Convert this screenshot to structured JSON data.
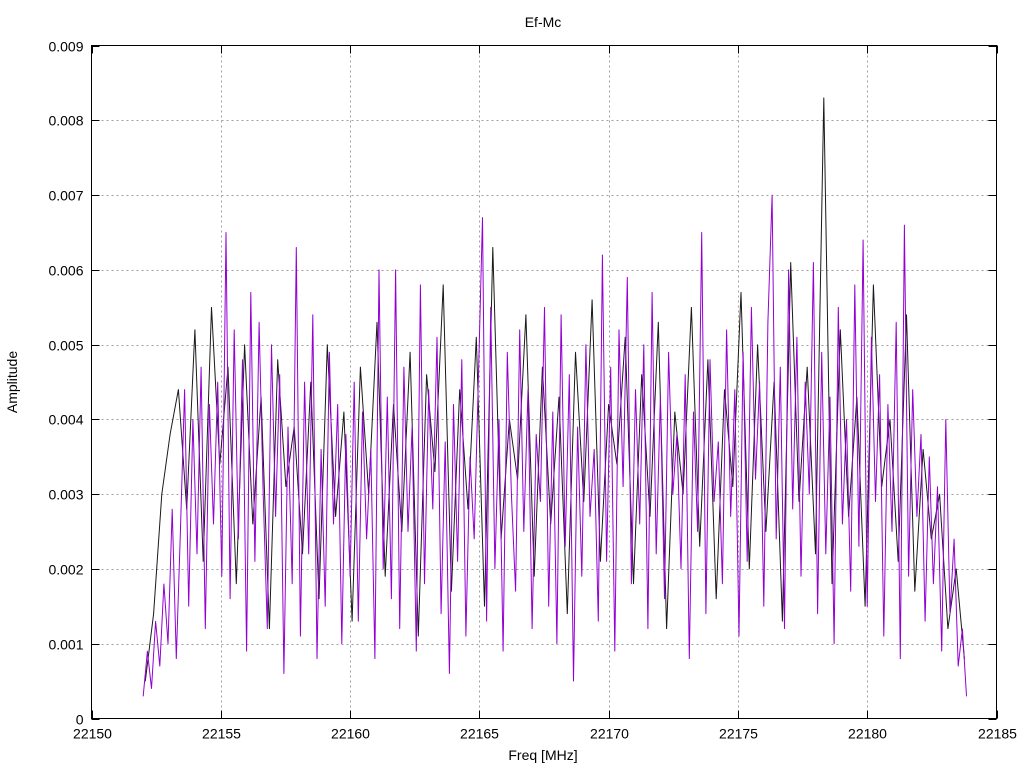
{
  "chart_data": {
    "type": "line",
    "title": "Ef-Mc",
    "xlabel": "Freq [MHz]",
    "ylabel": "Amplitude",
    "xlim": [
      22150,
      22185
    ],
    "ylim": [
      0,
      0.009
    ],
    "grid": true,
    "x_ticks": [
      "22150",
      "22155",
      "22160",
      "22165",
      "22170",
      "22175",
      "22180",
      "22185"
    ],
    "x_tick_values": [
      22150,
      22155,
      22160,
      22165,
      22170,
      22175,
      22180,
      22185
    ],
    "y_ticks": [
      "0",
      "0.001",
      "0.002",
      "0.003",
      "0.004",
      "0.005",
      "0.006",
      "0.007",
      "0.008",
      "0.009"
    ],
    "y_tick_values": [
      0,
      0.001,
      0.002,
      0.003,
      0.004,
      0.005,
      0.006,
      0.007,
      0.008,
      0.009
    ],
    "series": [
      {
        "color": "#1a1a1a",
        "x_start": 22152.08,
        "x_step": 0.32,
        "values": [
          0.0005,
          0.0014,
          0.003,
          0.0038,
          0.0044,
          0.0028,
          0.0052,
          0.0021,
          0.0055,
          0.0034,
          0.0047,
          0.0018,
          0.005,
          0.0026,
          0.0043,
          0.0012,
          0.0048,
          0.0031,
          0.0039,
          0.0022,
          0.0045,
          0.0016,
          0.005,
          0.0027,
          0.0041,
          0.0013,
          0.0047,
          0.003,
          0.0053,
          0.0019,
          0.0042,
          0.0025,
          0.0049,
          0.0011,
          0.0046,
          0.0033,
          0.0058,
          0.0017,
          0.0044,
          0.0028,
          0.0051,
          0.0015,
          0.0063,
          0.0024,
          0.004,
          0.0032,
          0.0054,
          0.0019,
          0.0047,
          0.0026,
          0.0043,
          0.0014,
          0.0049,
          0.0029,
          0.0056,
          0.0021,
          0.0042,
          0.0034,
          0.0051,
          0.0018,
          0.0046,
          0.0027,
          0.0053,
          0.0012,
          0.0041,
          0.003,
          0.0055,
          0.0023,
          0.0048,
          0.0016,
          0.0044,
          0.0031,
          0.0057,
          0.002,
          0.005,
          0.0025,
          0.0045,
          0.0013,
          0.0061,
          0.0029,
          0.0047,
          0.0022,
          0.0083,
          0.0018,
          0.0052,
          0.0027,
          0.0043,
          0.0015,
          0.0058,
          0.0031,
          0.004,
          0.0021,
          0.0054,
          0.0017,
          0.0036,
          0.0024,
          0.003,
          0.0012,
          0.002,
          0.0008
        ]
      },
      {
        "color": "#9400d3",
        "x_start": 22152.0,
        "x_step": 0.16,
        "values": [
          0.0003,
          0.0009,
          0.0004,
          0.0013,
          0.0007,
          0.0018,
          0.001,
          0.0028,
          0.0008,
          0.0025,
          0.0044,
          0.0015,
          0.004,
          0.0022,
          0.0047,
          0.0012,
          0.0042,
          0.0026,
          0.0045,
          0.0019,
          0.0065,
          0.0016,
          0.0052,
          0.0024,
          0.0048,
          0.0009,
          0.0057,
          0.0021,
          0.0053,
          0.003,
          0.0012,
          0.005,
          0.0027,
          0.0046,
          0.0006,
          0.0039,
          0.0018,
          0.0063,
          0.0011,
          0.0045,
          0.0022,
          0.0054,
          0.0008,
          0.0036,
          0.0015,
          0.0049,
          0.0026,
          0.0042,
          0.001,
          0.0038,
          0.0019,
          0.0045,
          0.0013,
          0.0041,
          0.0024,
          0.0036,
          0.0008,
          0.006,
          0.002,
          0.0043,
          0.0016,
          0.006,
          0.0012,
          0.0047,
          0.0025,
          0.0039,
          0.0009,
          0.0058,
          0.0018,
          0.0044,
          0.0028,
          0.0051,
          0.0014,
          0.0037,
          0.0006,
          0.0042,
          0.0021,
          0.0048,
          0.0011,
          0.0035,
          0.0024,
          0.0045,
          0.0067,
          0.0013,
          0.0055,
          0.002,
          0.004,
          0.0009,
          0.0049,
          0.003,
          0.0017,
          0.0052,
          0.0025,
          0.0044,
          0.0012,
          0.0038,
          0.0029,
          0.0055,
          0.0015,
          0.0041,
          0.001,
          0.0054,
          0.0023,
          0.0046,
          0.0005,
          0.0039,
          0.0019,
          0.005,
          0.0027,
          0.0036,
          0.0013,
          0.0062,
          0.0021,
          0.0047,
          0.0009,
          0.0052,
          0.0031,
          0.0059,
          0.0018,
          0.0044,
          0.0026,
          0.005,
          0.0012,
          0.0057,
          0.0022,
          0.0043,
          0.0016,
          0.0049,
          0.003,
          0.0038,
          0.002,
          0.0046,
          0.0008,
          0.0041,
          0.0025,
          0.0065,
          0.0014,
          0.0048,
          0.0029,
          0.0037,
          0.0018,
          0.0052,
          0.0027,
          0.0044,
          0.0011,
          0.0049,
          0.0021,
          0.0055,
          0.0032,
          0.0045,
          0.0015,
          0.0053,
          0.007,
          0.0024,
          0.0047,
          0.0012,
          0.006,
          0.0028,
          0.0051,
          0.0019,
          0.0045,
          0.003,
          0.0061,
          0.0014,
          0.0049,
          0.0022,
          0.0043,
          0.001,
          0.0055,
          0.0026,
          0.004,
          0.0017,
          0.0058,
          0.0023,
          0.0064,
          0.0015,
          0.0051,
          0.0029,
          0.0046,
          0.0011,
          0.0042,
          0.0025,
          0.0053,
          0.0008,
          0.0066,
          0.0019,
          0.0044,
          0.0027,
          0.0038,
          0.0013,
          0.0035,
          0.0018,
          0.0031,
          0.0009,
          0.004,
          0.0014,
          0.0024,
          0.0007,
          0.0012,
          0.0003
        ]
      }
    ]
  }
}
